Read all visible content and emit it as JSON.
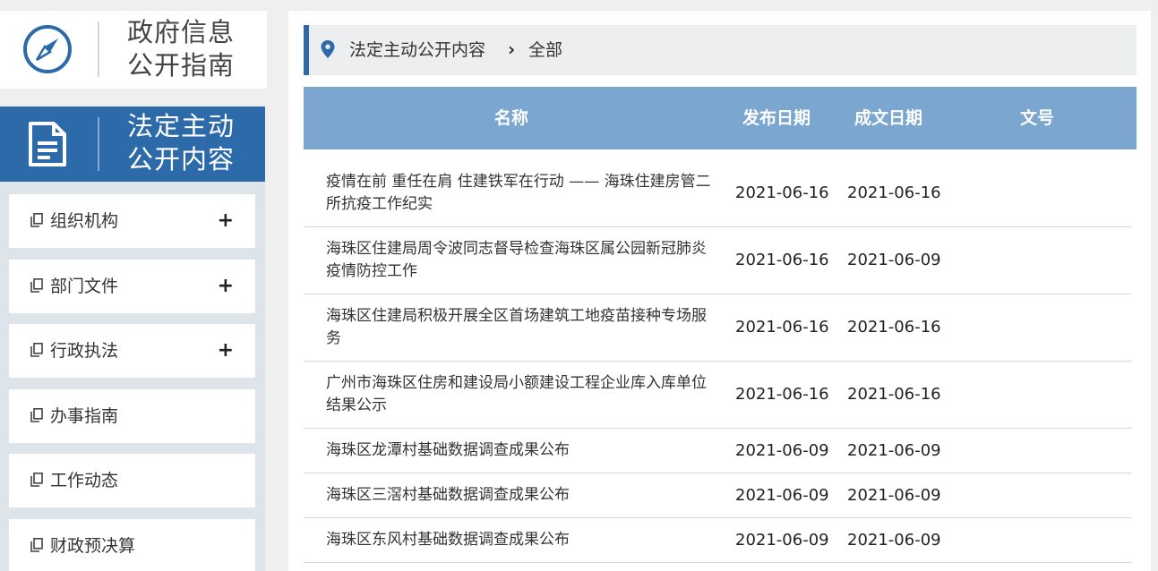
{
  "sidebar": {
    "guide_title": "政府信息公开指南",
    "guide_icon": "compass-icon",
    "active_title": "法定主动公开内容",
    "active_icon": "document-icon",
    "items": [
      {
        "label": "组织机构",
        "expandable": "+"
      },
      {
        "label": "部门文件",
        "expandable": "+"
      },
      {
        "label": "行政执法",
        "expandable": "+"
      },
      {
        "label": "办事指南",
        "expandable": ""
      },
      {
        "label": "工作动态",
        "expandable": ""
      },
      {
        "label": "财政预决算",
        "expandable": ""
      }
    ]
  },
  "breadcrumb": {
    "icon": "location-pin-icon",
    "level1": "法定主动公开内容",
    "separator": "›",
    "level2": "全部"
  },
  "table": {
    "headers": {
      "name": "名称",
      "publish_date": "发布日期",
      "doc_date": "成文日期",
      "doc_no": "文号"
    },
    "rows": [
      {
        "title": "疫情在前 重任在肩 住建铁军在行动 —— 海珠住建房管二所抗疫工作纪实",
        "publish_date": "2021-06-16",
        "doc_date": "2021-06-16",
        "doc_no": ""
      },
      {
        "title": "海珠区住建局周令波同志督导检查海珠区属公园新冠肺炎疫情防控工作",
        "publish_date": "2021-06-16",
        "doc_date": "2021-06-09",
        "doc_no": ""
      },
      {
        "title": "海珠区住建局积极开展全区首场建筑工地疫苗接种专场服务",
        "publish_date": "2021-06-16",
        "doc_date": "2021-06-16",
        "doc_no": ""
      },
      {
        "title": "广州市海珠区住房和建设局小额建设工程企业库入库单位结果公示",
        "publish_date": "2021-06-16",
        "doc_date": "2021-06-16",
        "doc_no": ""
      },
      {
        "title": "海珠区龙潭村基础数据调查成果公布",
        "publish_date": "2021-06-09",
        "doc_date": "2021-06-09",
        "doc_no": ""
      },
      {
        "title": "海珠区三滘村基础数据调查成果公布",
        "publish_date": "2021-06-09",
        "doc_date": "2021-06-09",
        "doc_no": ""
      },
      {
        "title": "海珠区东风村基础数据调查成果公布",
        "publish_date": "2021-06-09",
        "doc_date": "2021-06-09",
        "doc_no": ""
      }
    ]
  },
  "colors": {
    "brand_blue": "#2c6aa9",
    "table_header": "#7aa6cf",
    "menu_bg": "#dde5ea"
  }
}
